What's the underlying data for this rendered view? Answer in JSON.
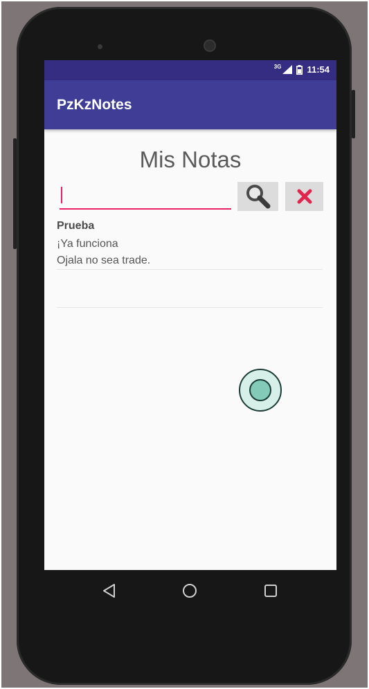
{
  "status_bar": {
    "network": "3G",
    "time": "11:54"
  },
  "app_bar": {
    "title": "PzKzNotes"
  },
  "main": {
    "heading": "Mis Notas",
    "search": {
      "value": "",
      "placeholder": ""
    },
    "search_icon": "search-icon",
    "clear_icon": "close-icon",
    "notes": [
      {
        "title": "Prueba",
        "lines": [
          "¡Ya funciona",
          "Ojala no sea trade."
        ]
      }
    ]
  },
  "nav_bar": {
    "buttons": [
      "back-icon",
      "home-icon",
      "recents-icon"
    ]
  },
  "colors": {
    "status_bar": "#342d82",
    "app_bar": "#3f3d95",
    "accent": "#e91e63",
    "clear_icon": "#e0264f"
  }
}
